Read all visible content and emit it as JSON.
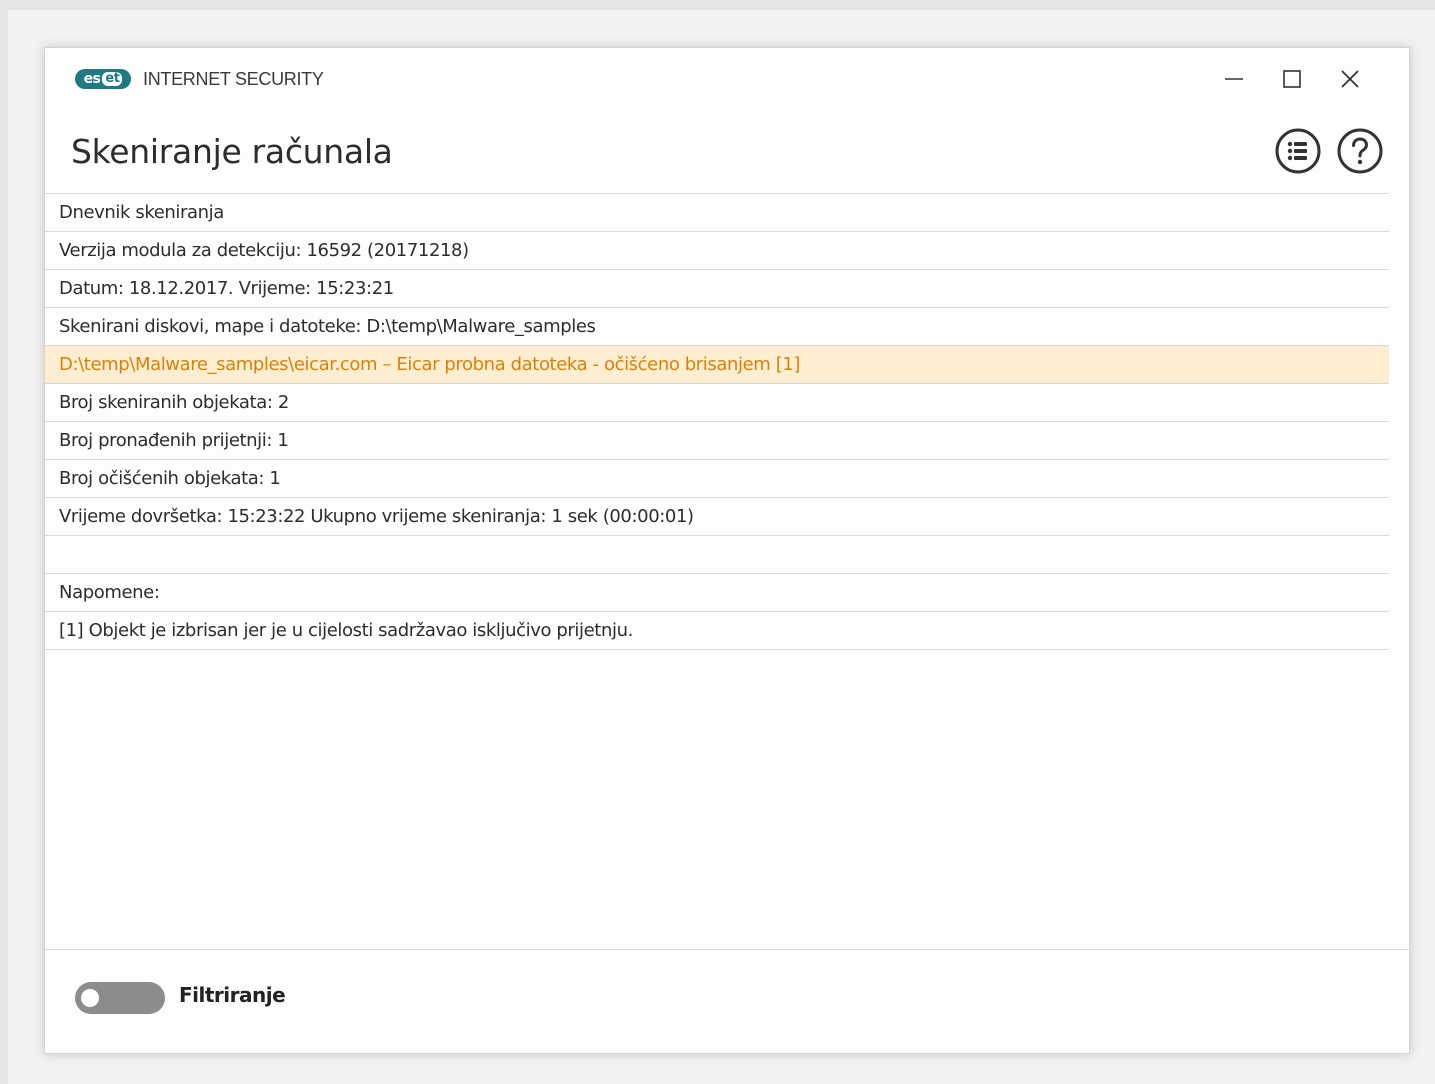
{
  "app": {
    "logo_text_1": "es",
    "logo_text_2": "et",
    "product_name": "INTERNET SECURITY"
  },
  "window_controls": {
    "minimize": "minimize",
    "maximize": "maximize",
    "close": "close"
  },
  "header": {
    "title": "Skeniranje računala",
    "menu_icon": "list-icon",
    "help_icon": "help-icon"
  },
  "log": {
    "rows": [
      "Dnevnik skeniranja",
      "Verzija modula za detekciju: 16592 (20171218)",
      "Datum: 18.12.2017.  Vrijeme: 15:23:21",
      "Skenirani diskovi, mape i datoteke: D:\\temp\\Malware_samples",
      "D:\\temp\\Malware_samples\\eicar.com – Eicar probna datoteka - očišćeno brisanjem [1]",
      "Broj skeniranih objekata: 2",
      "Broj pronađenih prijetnji: 1",
      "Broj očišćenih objekata: 1",
      "Vrijeme dovršetka: 15:23:22  Ukupno vrijeme skeniranja: 1 sek (00:00:01)",
      "",
      "Napomene:",
      "[1] Objekt je izbrisan jer je u cijelosti sadržavao isključivo prijetnju."
    ],
    "highlight_color": "#d9820a",
    "highlight_bg": "#fdedd1"
  },
  "footer": {
    "filter_label": "Filtriranje",
    "filter_enabled": false
  },
  "colors": {
    "brand": "#1f7a84"
  }
}
